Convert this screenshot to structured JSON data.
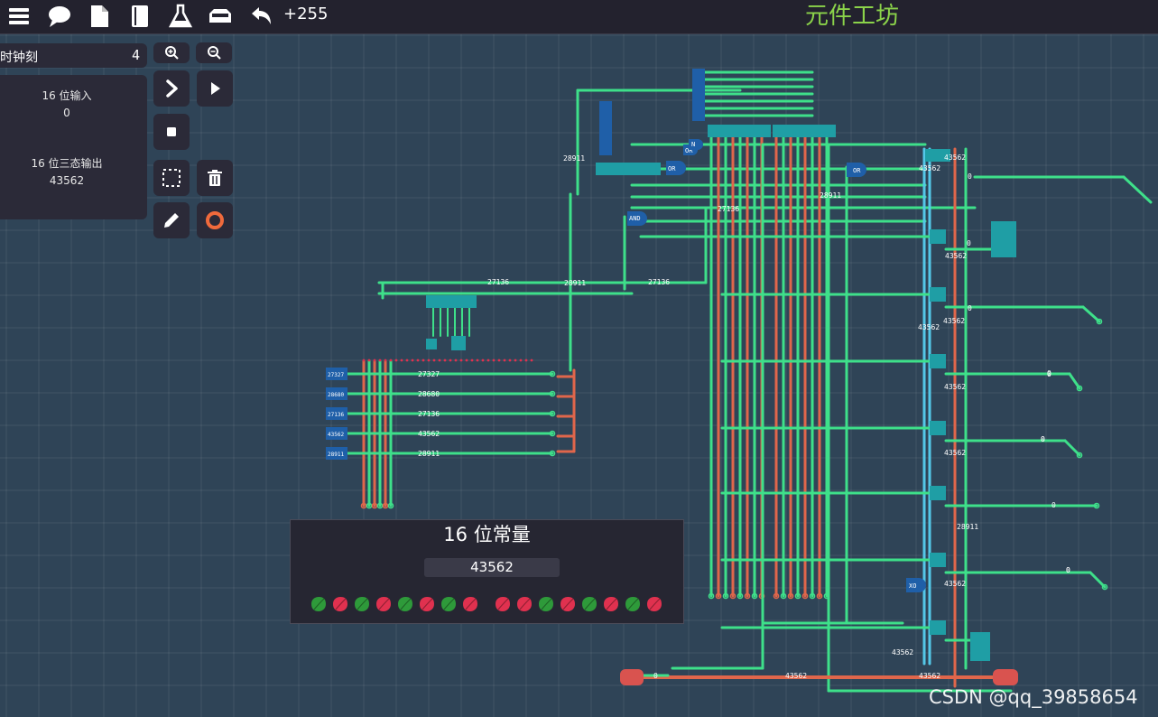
{
  "toolbar": {
    "icons": [
      "menu-icon",
      "chat-icon",
      "file-icon",
      "book-icon",
      "flask-icon",
      "tray-icon",
      "undo-icon"
    ],
    "counter": "+255",
    "app_title": "元件工坊"
  },
  "clock": {
    "label": "时钟刻",
    "value": "4"
  },
  "side_panel": {
    "items": [
      {
        "label": "16 位输入",
        "value": "0"
      },
      {
        "label": "16 位三态输出",
        "value": "43562"
      }
    ]
  },
  "tools": [
    "zoom-in-icon",
    "zoom-out-icon",
    "step-icon",
    "play-icon",
    "stop-icon",
    "select-icon",
    "delete-icon",
    "pencil-icon",
    "ring-icon"
  ],
  "constant_panel": {
    "title": "16 位常量",
    "value": "43562",
    "bits": [
      0,
      1,
      0,
      1,
      0,
      1,
      0,
      1,
      1,
      1,
      0,
      1,
      0,
      1,
      0,
      1
    ],
    "colors": {
      "on": "#e0314f",
      "off": "#2e9a3a"
    }
  },
  "circuit": {
    "labels": [
      "27136",
      "28911",
      "27136",
      "28911",
      "27136",
      "43562",
      "27327",
      "28680",
      "27136",
      "43562",
      "28911",
      "43562",
      "28911",
      "43562",
      "0",
      "43562",
      "0",
      "43562",
      "0",
      "43562",
      "28911",
      "0",
      "0",
      "43562",
      "43562",
      "0",
      "43562",
      "43562",
      "43562"
    ],
    "left_inputs": [
      "27327",
      "28680",
      "27136",
      "43562",
      "28911"
    ],
    "gate_labels": [
      "OR",
      "AND",
      "OR",
      "XO",
      "OR",
      "N"
    ],
    "output_labels": [
      "0",
      "0",
      "0",
      "0",
      "0"
    ],
    "colors": {
      "wire": "#3ee08a",
      "bus": "#e0664b",
      "vbus": "#54c8e8",
      "chip": "#1f9ea5"
    }
  },
  "watermark": "CSDN @qq_39858654"
}
